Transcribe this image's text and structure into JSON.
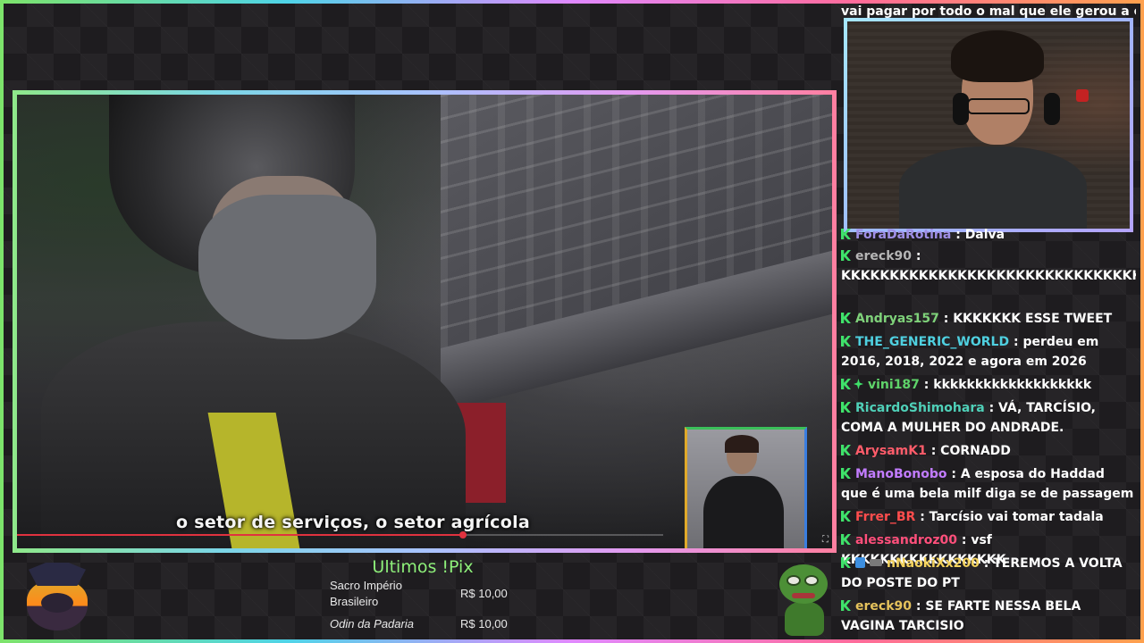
{
  "video": {
    "subtitle": "o setor de serviços, o setor agrícola",
    "progress_percent": 69
  },
  "chat": {
    "top_partial": "vai pagar por todo o mal que ele gerou a esse",
    "messages": [
      {
        "user": "ForaDaRotina",
        "color": "#9f8fe6",
        "text": ": Dalva",
        "badges": [
          "k"
        ]
      },
      {
        "user": "ereck90",
        "color": "#b6b6b6",
        "text": ": KKKKKKKKKKKKKKKKKKKKKKKKKKKKKKKKKKKKKKKKKKKKKKKKKKKKKK",
        "badges": [
          "k"
        ]
      },
      {
        "user": "Andryas157",
        "color": "#7fd27a",
        "text": ": KKKKKKK ESSE TWEET",
        "badges": [
          "k"
        ]
      },
      {
        "user": "THE_GENERIC_WORLD",
        "color": "#4fd0e0",
        "text": ": perdeu em 2016, 2018, 2022 e agora em 2026",
        "badges": [
          "k"
        ]
      },
      {
        "user": "vini187",
        "color": "#5fd36a",
        "text": ": kkkkkkkkkkkkkkkkkkk",
        "badges": [
          "k",
          "spark"
        ]
      },
      {
        "user": "RicardoShimohara",
        "color": "#4fd0b8",
        "text": ": VÁ, TARCÍSIO, COMA A MULHER DO ANDRADE.",
        "badges": [
          "k"
        ]
      },
      {
        "user": "ArysamK1",
        "color": "#ff5c6a",
        "text": ": CORNADD",
        "badges": [
          "k"
        ]
      },
      {
        "user": "ManoBonobo",
        "color": "#c27cff",
        "text": ": A esposa do Haddad que é uma bela milf diga se de passagem",
        "badges": [
          "k"
        ]
      },
      {
        "user": "Frrer_BR",
        "color": "#ff4d4d",
        "text": ": Tarcísio vai tomar tadala",
        "badges": [
          "k"
        ]
      },
      {
        "user": "alessandroz00",
        "color": "#ff4f7b",
        "text": ": vsf KKKKKKKKKKKKKKKKK",
        "badges": [
          "k"
        ]
      },
      {
        "user": "nNaokiXx200",
        "color": "#f4d35e",
        "text": ": TEREMOS A VOLTA DO POSTE DO PT",
        "badges": [
          "k",
          "cube",
          "small"
        ]
      },
      {
        "user": "ereck90",
        "color": "#e6c35c",
        "text": ": SE FARTE NESSA BELA VAGINA TARCISIO",
        "badges": [
          "k"
        ]
      }
    ]
  },
  "pix": {
    "title": "Ultimos !Pix",
    "rows": [
      {
        "name": "Sacro Império Brasileiro",
        "value": "R$ 10,00"
      },
      {
        "name": "Odin da Padaria",
        "value": "R$ 10,00"
      }
    ]
  },
  "icons": {
    "chat_badge": "k-badge-icon",
    "fullscreen": "fullscreen-icon"
  },
  "colors": {
    "pix_title": "#8ef07a",
    "progress": "#e0323f",
    "badge": "#3fe26a"
  }
}
